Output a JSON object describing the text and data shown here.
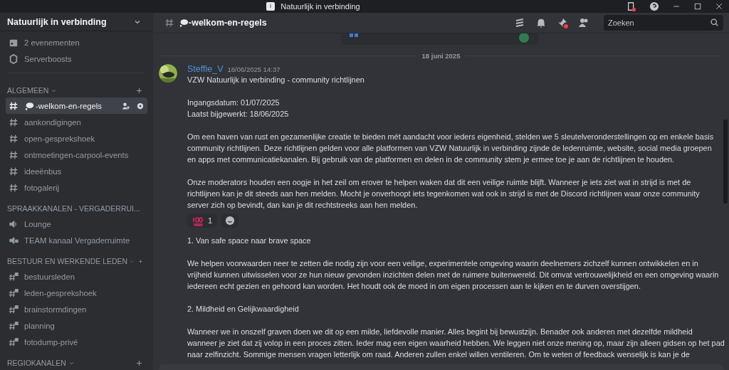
{
  "window": {
    "title": "Natuurlijk in verbinding"
  },
  "server": {
    "name": "Natuurlijk in verbinding",
    "events": "2 evenementen",
    "boosts": "Serverboosts"
  },
  "categories": [
    {
      "name": "ALGEMEEN",
      "channels": [
        {
          "name": "-welkom-en-regels",
          "kind": "rules",
          "selected": true
        },
        {
          "name": "aankondigingen",
          "kind": "text",
          "selected": false
        },
        {
          "name": "open-gesprekshoek",
          "kind": "text",
          "selected": false
        },
        {
          "name": "ontmoetingen-carpool-events",
          "kind": "text",
          "selected": false
        },
        {
          "name": "ideeënbus",
          "kind": "text",
          "selected": false
        },
        {
          "name": "fotogalerij",
          "kind": "text",
          "selected": false
        }
      ]
    },
    {
      "name": "SPRAAKKANALEN - VERGADERRUI...",
      "channels": [
        {
          "name": "Lounge",
          "kind": "voice",
          "selected": false
        },
        {
          "name": "TEAM kanaal Vergaderruimte",
          "kind": "voice-private",
          "selected": false
        }
      ]
    },
    {
      "name": "BESTUUR EN WERKENDE LEDEN",
      "channels": [
        {
          "name": "bestuursleden",
          "kind": "private",
          "selected": false
        },
        {
          "name": "leden-gesprekshoek",
          "kind": "private",
          "selected": false
        },
        {
          "name": "brainstormdingen",
          "kind": "private",
          "selected": false
        },
        {
          "name": "planning",
          "kind": "private",
          "selected": false
        },
        {
          "name": "fotodump-privé",
          "kind": "private",
          "selected": false
        }
      ]
    },
    {
      "name": "REGIOKANALEN"
    }
  ],
  "channel": {
    "name": "-welkom-en-regels",
    "search_placeholder": "Zoeken"
  },
  "date_divider": "18 juni 2025",
  "message": {
    "author": "Steffie_V",
    "timestamp": "18/06/2025 14:37",
    "blocks": [
      {
        "kind": "text",
        "lines": [
          "VZW Natuurlijk in verbinding - community richtlijnen"
        ]
      },
      {
        "kind": "text",
        "lines": [
          "Ingangsdatum: 01/07/2025",
          "Laatst bijgewerkt: 18/06/2025"
        ]
      },
      {
        "kind": "text",
        "lines": [
          "Om een haven van rust en gezamenlijke creatie te bieden mét aandacht voor ieders eigenheid, stelden we 5 sleutelveronderstellingen op en enkele basis",
          "community richtlijnen. Deze richtlijnen gelden voor alle platformen van VZW Natuurlijk in verbinding zijnde de ledenruimte, website, social media groepen",
          "en apps met communicatiekanalen. Bij gebruik van de platformen en delen in de community stem je ermee toe je aan de richtlijnen te houden."
        ]
      },
      {
        "kind": "text",
        "lines": [
          "Onze moderators houden een oogje in het zeil om erover te helpen waken dat dit een veilige ruimte blijft. Wanneer je iets ziet wat in strijd is met de",
          "richtlijnen kan je dit steeds aan hen melden. Mocht je onverhoopt iets tegenkomen wat ook in strijd is met de Discord richtlijnen waar onze community",
          "server zich op bevindt, dan kan je dit rechtstreeks aan hen melden."
        ]
      },
      {
        "kind": "reactions",
        "items": [
          {
            "count": "1",
            "selected": false
          }
        ]
      },
      {
        "kind": "text",
        "lines": [
          "1. Van safe space naar brave space"
        ]
      },
      {
        "kind": "text",
        "lines": [
          "We helpen voorwaarden neer te zetten die nodig zijn voor een veilige, experimentele omgeving waarin deelnemers zichzelf kunnen ontwikkelen en in",
          "vrijheid kunnen uitwisselen voor ze hun nieuw gevonden inzichten delen met de ruimere buitenwereld. Dit omvat vertrouwelijkheid en een omgeving waarin",
          "iedereen echt gezien en gehoord kan worden. Het houdt ook de moed in om eigen processen aan te kijken en te durven overstijgen."
        ]
      },
      {
        "kind": "text",
        "lines": [
          "2. Mildheid en Gelijkwaardigheid"
        ]
      },
      {
        "kind": "text",
        "lines": [
          "Wanneer we in onszelf graven doen we dit op een milde, liefdevolle manier. Alles begint bij bewustzijn. Benader ook anderen met dezelfde mildheid",
          "wanneer je ziet dat zij volop in een proces zitten. Ieder mag een eigen waarheid hebben. We leggen niet onze mening op, maar zijn alleen gidsen op het pad",
          "naar zelfinzicht. Sommige mensen vragen letterlijk om raad. Anderen zullen enkel willen ventileren. Om te weten of feedback wenselijk is kan je de"
        ]
      }
    ]
  }
}
